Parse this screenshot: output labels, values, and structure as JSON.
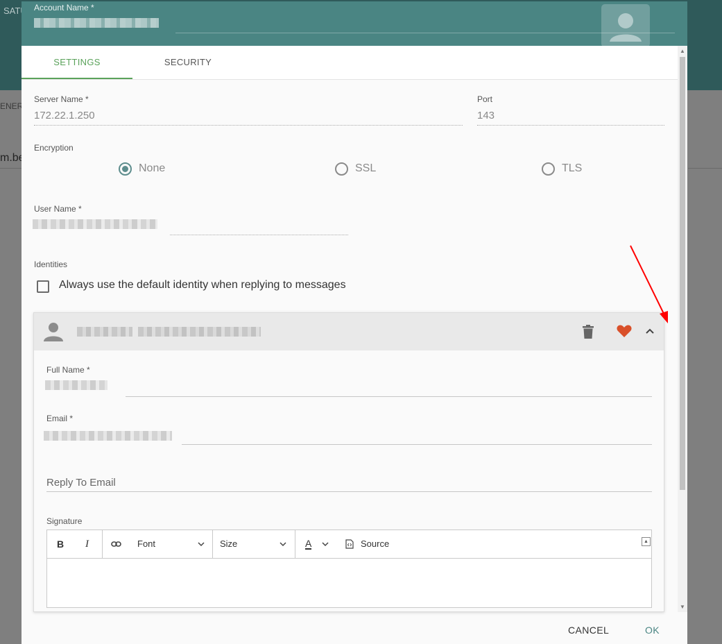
{
  "background": {
    "top_label": "SATU",
    "general_label": "ENERA",
    "address_fragment": "m.be"
  },
  "dialog": {
    "account_name_label": "Account Name *",
    "tabs": [
      {
        "label": "SETTINGS",
        "active": true
      },
      {
        "label": "SECURITY",
        "active": false
      }
    ],
    "server_name_label": "Server Name *",
    "server_name_value": "172.22.1.250",
    "port_label": "Port",
    "port_value": "143",
    "encryption_label": "Encryption",
    "encryption_options": [
      {
        "label": "None",
        "checked": true
      },
      {
        "label": "SSL",
        "checked": false
      },
      {
        "label": "TLS",
        "checked": false
      }
    ],
    "user_name_label": "User Name *",
    "identities_label": "Identities",
    "default_identity_checkbox": {
      "label": "Always use the default identity when replying to messages",
      "checked": false
    },
    "identity": {
      "full_name_label": "Full Name *",
      "email_label": "Email *",
      "reply_to_placeholder": "Reply To Email",
      "signature_label": "Signature",
      "toolbar": {
        "bold": "B",
        "italic": "I",
        "font": "Font",
        "size": "Size",
        "text_color": "A",
        "source": "Source"
      }
    },
    "footer": {
      "cancel": "CANCEL",
      "ok": "OK"
    }
  },
  "colors": {
    "header_teal": "#4a8583",
    "tab_active_green": "#5aa25a",
    "favorite_heart": "#d9502a",
    "annotation_arrow": "#ff0000"
  }
}
